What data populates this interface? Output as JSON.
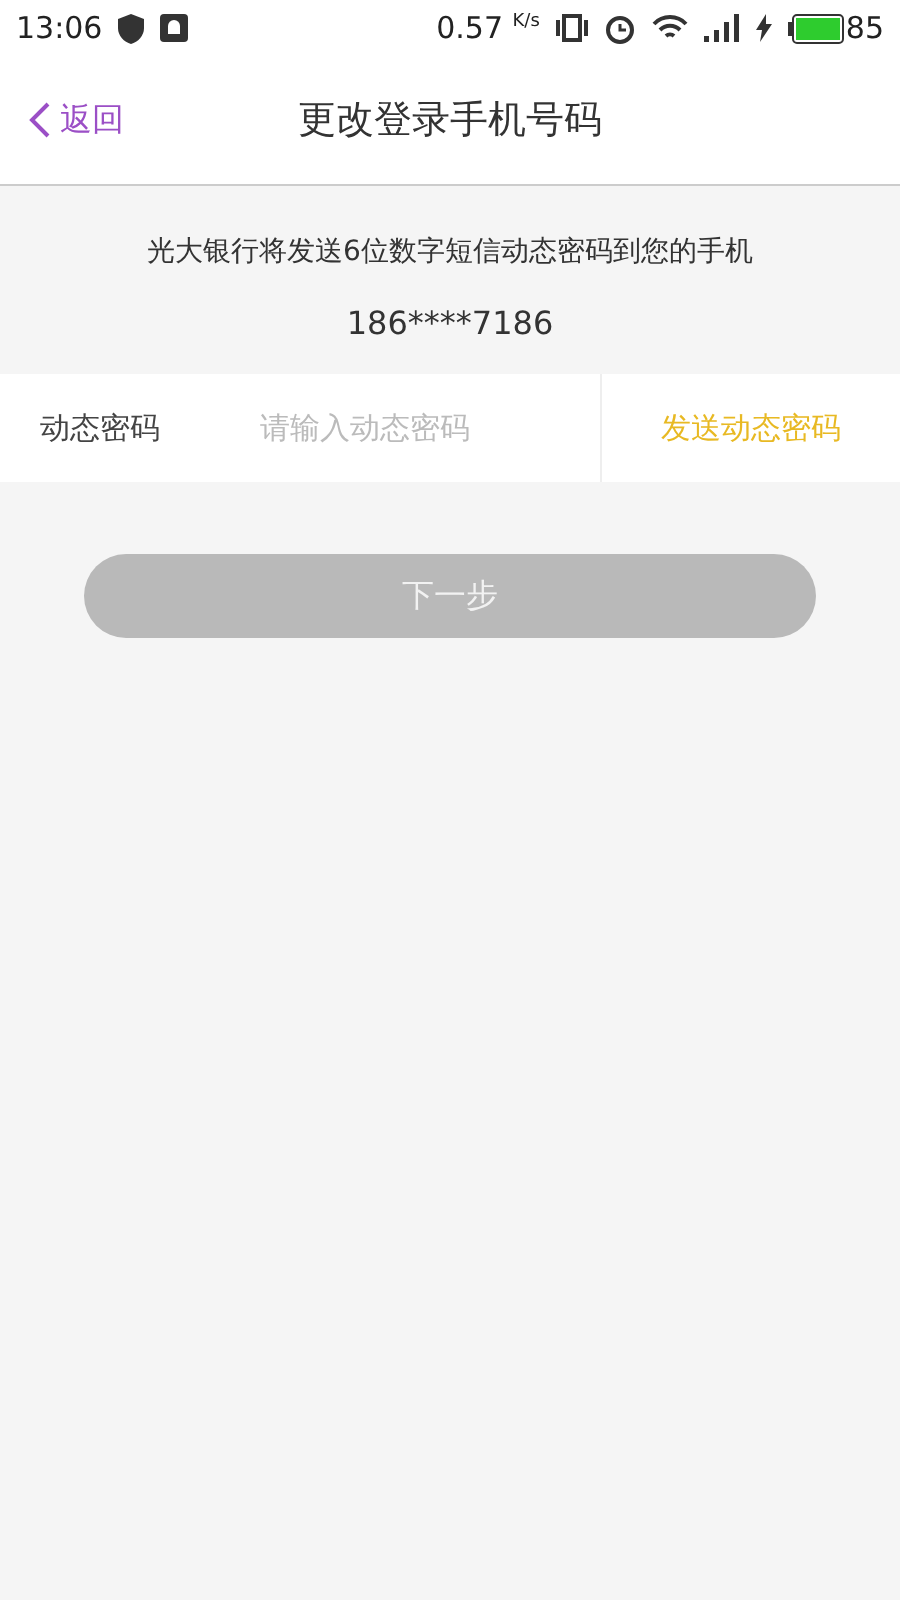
{
  "status_bar": {
    "time": "13:06",
    "speed": "0.57",
    "speed_unit": "K/s",
    "battery_level": "85"
  },
  "nav": {
    "back": "返回",
    "title": "更改登录手机号码"
  },
  "message": "光大银行将发送6位数字短信动态密码到您的手机",
  "phone": "186****7186",
  "code_field": {
    "label": "动态密码",
    "placeholder": "请输入动态密码",
    "send_button": "发送动态密码"
  },
  "next_button": {
    "label": "下一步",
    "disabled": true
  }
}
